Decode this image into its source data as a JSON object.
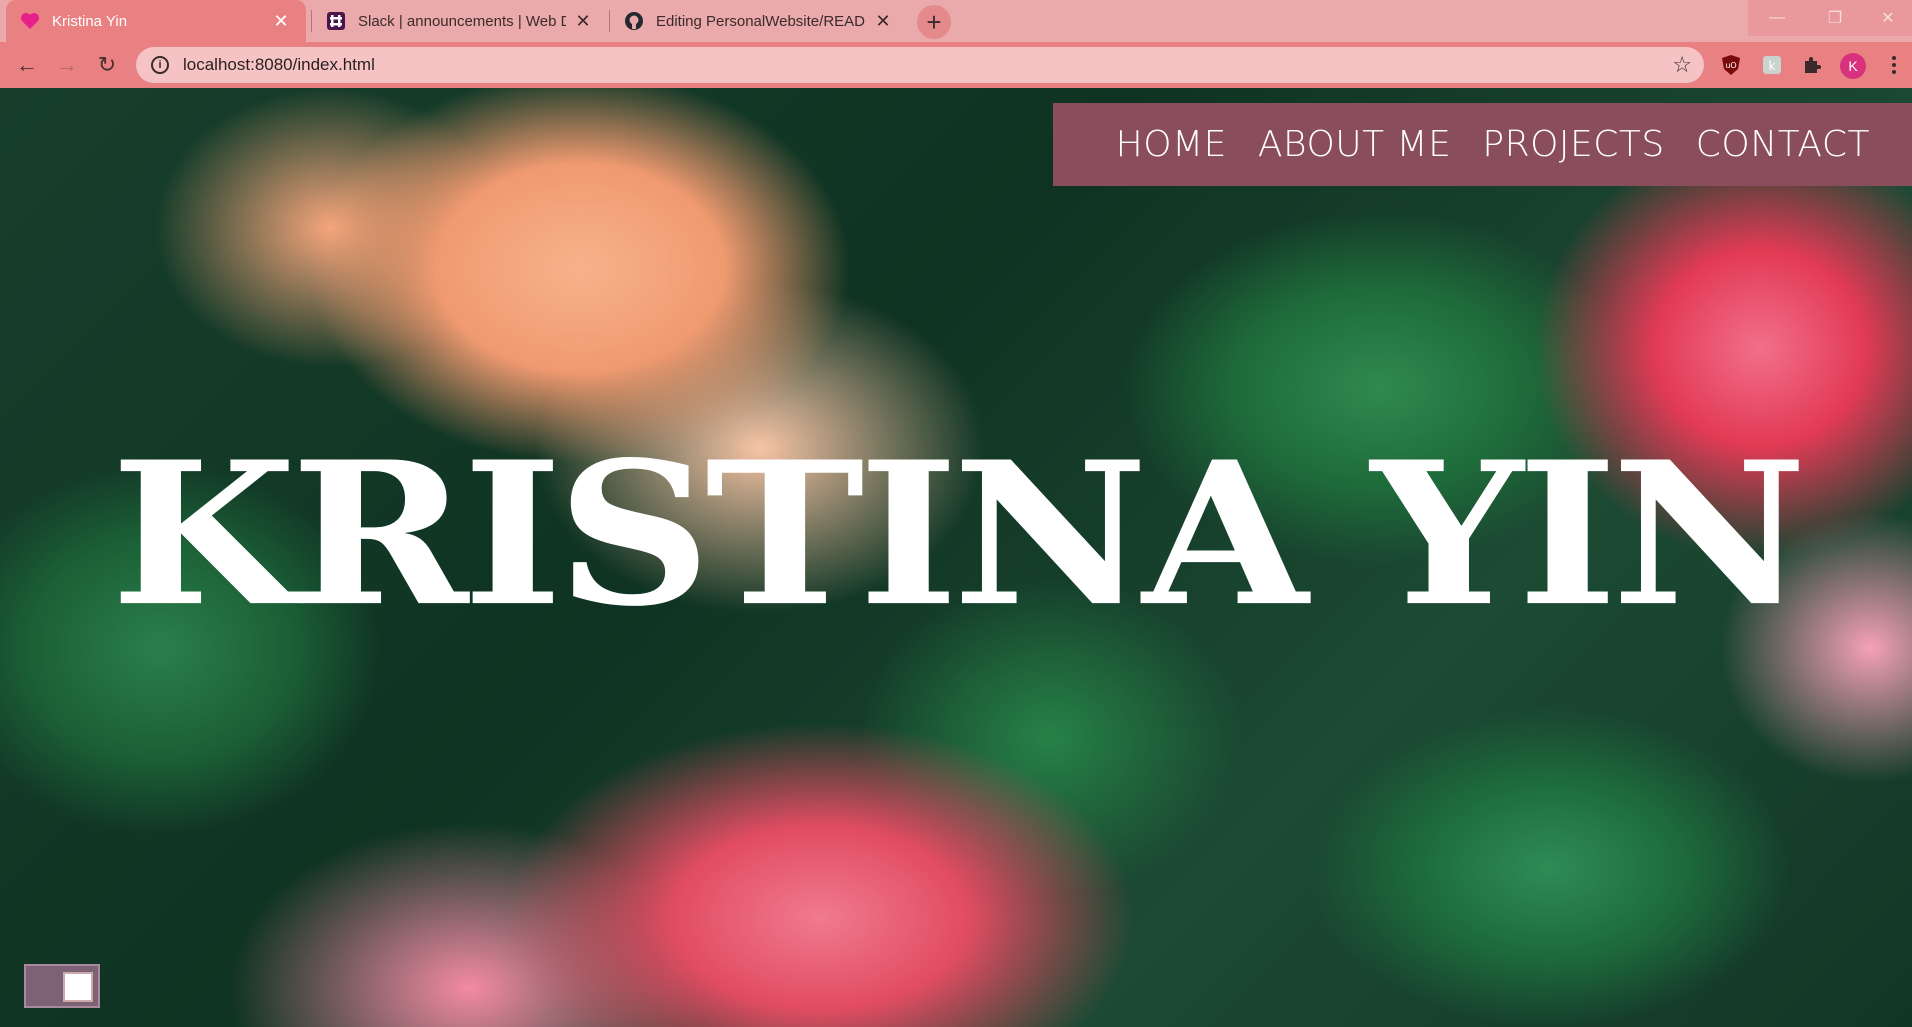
{
  "browser": {
    "tabs": [
      {
        "title": "Kristina Yin",
        "favicon": "heart-icon",
        "active": true
      },
      {
        "title": "Slack | announcements | Web De",
        "favicon": "slack-icon",
        "active": false
      },
      {
        "title": "Editing PersonalWebsite/READM",
        "favicon": "github-icon",
        "active": false
      }
    ],
    "url": "localhost:8080/index.html",
    "profile_initial": "K",
    "accent": "#e98182",
    "tabstrip_color": "#eaa9aa"
  },
  "site": {
    "nav": [
      "HOME",
      "ABOUT ME",
      "PROJECTS",
      "CONTACT"
    ],
    "nav_bg": "#8a4d5c",
    "hero_name": "KRISTINA YIN"
  }
}
